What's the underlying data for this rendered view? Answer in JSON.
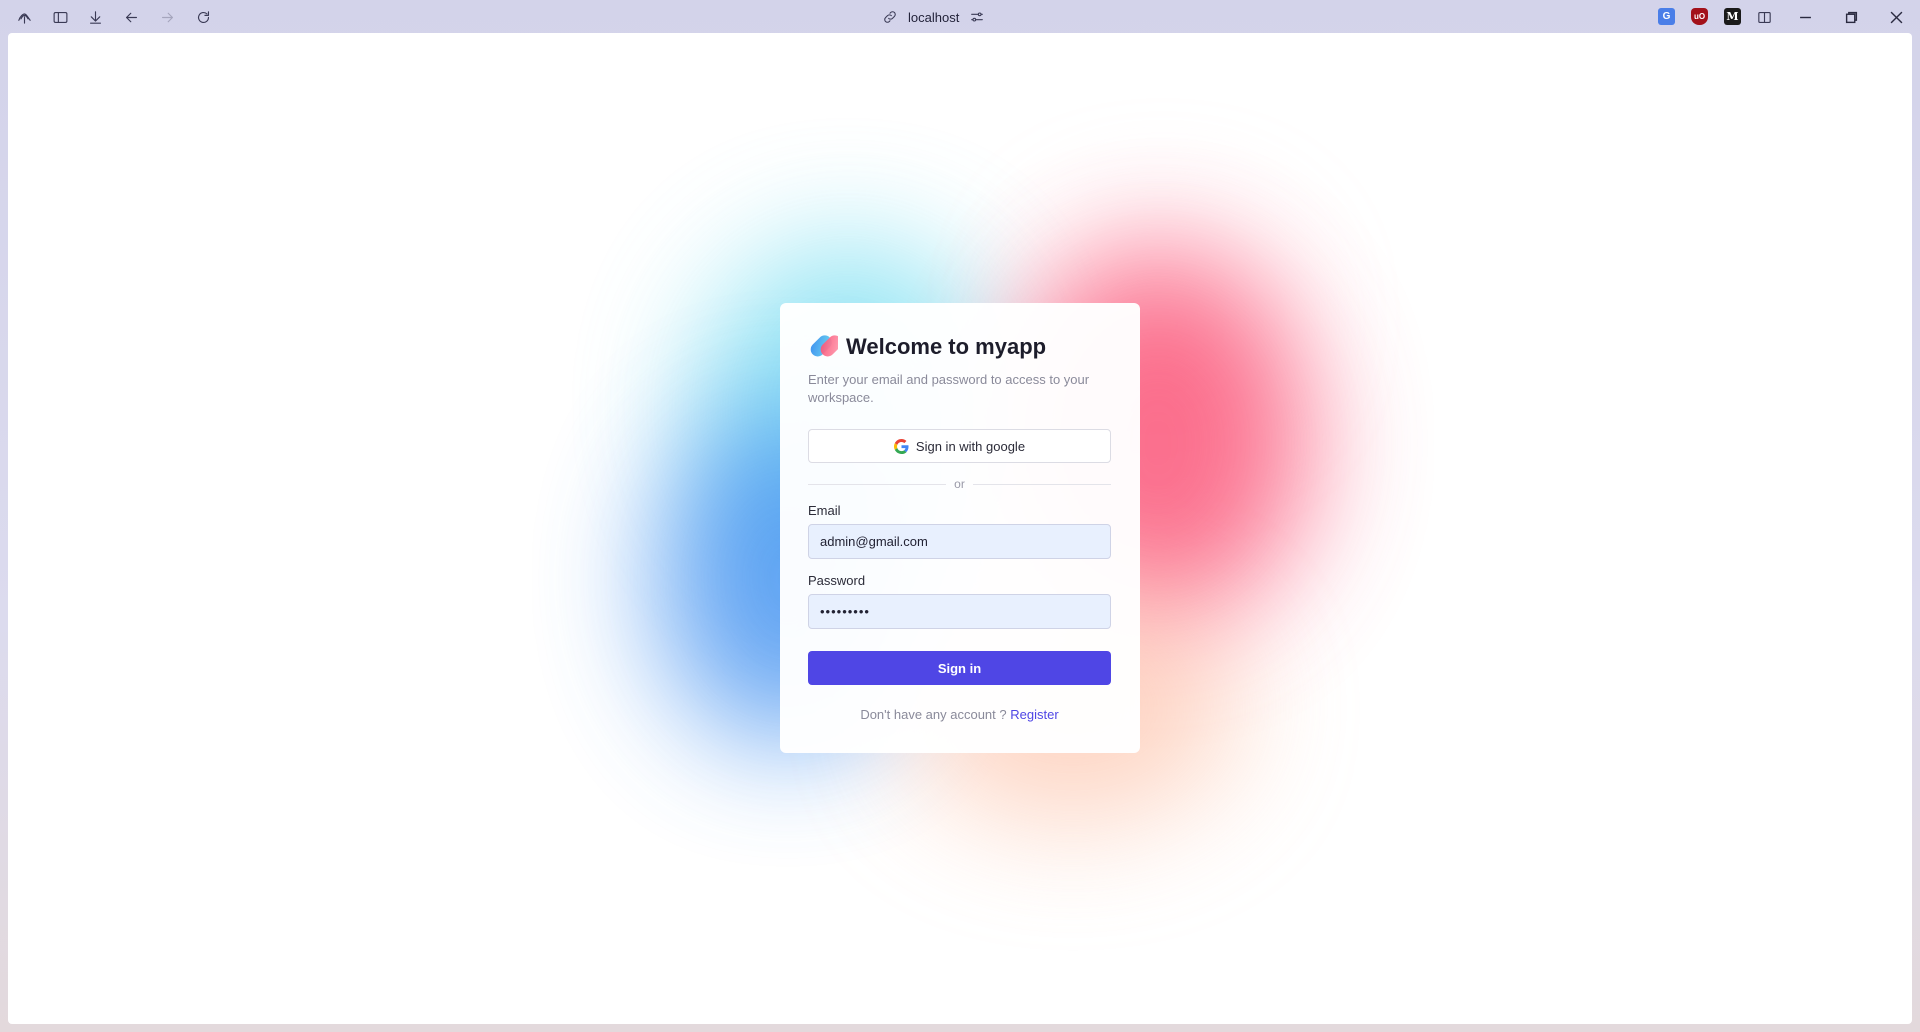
{
  "browser": {
    "address": "localhost",
    "icons": {
      "menu": "browser-logo-icon",
      "sidebar": "sidebar-toggle-icon",
      "download": "download-icon",
      "back": "back-arrow-icon",
      "forward": "forward-arrow-icon",
      "reload": "reload-icon",
      "link": "link-icon",
      "settings": "site-settings-icon"
    },
    "extensions": [
      {
        "name": "translate-extension-icon",
        "color": "#4a7ee8"
      },
      {
        "name": "ublock-extension-icon",
        "color": "#a3111a",
        "text": "uO"
      },
      {
        "name": "m-extension-icon",
        "color": "#1a1a1a",
        "text": "M"
      },
      {
        "name": "split-view-icon",
        "color": "#3a3a55"
      }
    ]
  },
  "login": {
    "title": "Welcome to myapp",
    "subtitle": "Enter your email and password to access to your workspace.",
    "google_label": "Sign in with google",
    "divider_label": "or",
    "email_label": "Email",
    "email_value": "admin@gmail.com",
    "password_label": "Password",
    "password_value": "•••••••••",
    "submit_label": "Sign in",
    "footer_text": "Don't have any account ?",
    "register_label": "Register"
  },
  "colors": {
    "accent": "#4f46e5",
    "field_bg": "#e8f0fe",
    "blob_cyan": "#6fdcf0",
    "blob_blue": "#3f8ff0",
    "blob_red": "#fa4d72",
    "blob_peach": "#fdb89a"
  }
}
